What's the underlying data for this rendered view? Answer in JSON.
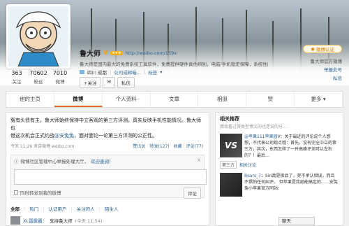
{
  "profile": {
    "name": "鲁大师",
    "url": "http://weibo.com/159x",
    "bio": "鲁大师是国内最大的免费系统工具软件，免费提供硬件真伪辨别，电脑/手机稳定保障，系统性能提升…",
    "stats": [
      {
        "num": "363",
        "label": "关注"
      },
      {
        "num": "70602",
        "label": "粉丝"
      },
      {
        "num": "7010",
        "label": "微博"
      }
    ],
    "tags": [
      "四川 成都",
      "公司或邮箱...",
      "标签"
    ],
    "follow_label": "+关注",
    "message_label": "私信",
    "cert_label": "微博认证",
    "cert_desc": "鲁大师官方微博",
    "report_label": "举报此号",
    "secret_label": "私信"
  },
  "nav": [
    "他的主页",
    "微博",
    "个人资料",
    "文章",
    "相册",
    "赞",
    "更多 ▾"
  ],
  "post": {
    "line1": "冤有头债有主，鲁大师始终保持中立客观的第三方评测，真实反映手机性能情况。鲁大师也",
    "line2a": "借这次机会正式约战",
    "mention": "@安兔兔",
    "line2b": "，面对面论一论第三方评测的公正性。",
    "time": "今天 11:26 来自微博 weibo.com",
    "actions": [
      "赞(59)",
      "转发(127)",
      "收藏",
      "评论(77)"
    ]
  },
  "comment_box": {
    "notice": "微博社区管理中心举报处理大厅，",
    "notice_link": "欢迎查阅！",
    "check_label": "同时转发到我的微博",
    "submit_label": "评论"
  },
  "filters": [
    "全部",
    "热门",
    "认证用户",
    "关注的人",
    "陌生人"
  ],
  "comment": {
    "name": "XL雷霆霸：",
    "text": "支持鲁大师",
    "time": "(今天 11:54)"
  },
  "sidebar": {
    "title": "相关推荐",
    "subtitle": "猜我看过得类型博文的也是说的分…",
    "entries": [
      {
        "who": "@苹果111苹果园",
        "text": "V：关于最近的评论说个人感想，不代表公司观点哦：首先，没有完全中立的第三方，其次，东西怎样了一并高峰评测可以左右的？！最后…",
        "badge": "第三方",
        "link": "相关讨论"
      },
      {
        "who": "Bears_7",
        "text": "：Siri真是极品了，死不承认错误，而且不惧怕任何纠评。 但苹果是我她能搞定的……安兔兔小苹果官方同站：",
        "badge": "",
        "link": ""
      }
    ],
    "chat_label": "聊天"
  }
}
